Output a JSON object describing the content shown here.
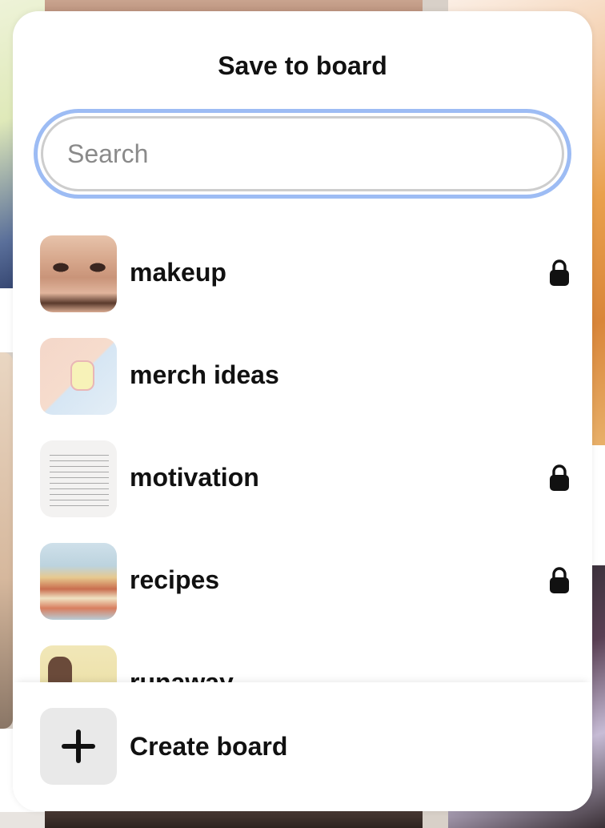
{
  "dialog": {
    "title": "Save to board",
    "search": {
      "placeholder": "Search",
      "value": ""
    }
  },
  "boards": [
    {
      "name": "makeup",
      "secret": true,
      "thumb_icon": "eyes-photo"
    },
    {
      "name": "merch ideas",
      "secret": false,
      "thumb_icon": "keychain-photo"
    },
    {
      "name": "motivation",
      "secret": true,
      "thumb_icon": "text-note-photo"
    },
    {
      "name": "recipes",
      "secret": true,
      "thumb_icon": "pancake-stack-photo"
    },
    {
      "name": "runaway",
      "secret": false,
      "thumb_icon": "anime-illustration"
    }
  ],
  "footer": {
    "create_label": "Create board",
    "icon": "plus-icon"
  },
  "colors": {
    "focus_ring": "#9dbcf4",
    "text": "#111111",
    "tile_gray": "#e9e9e9"
  }
}
